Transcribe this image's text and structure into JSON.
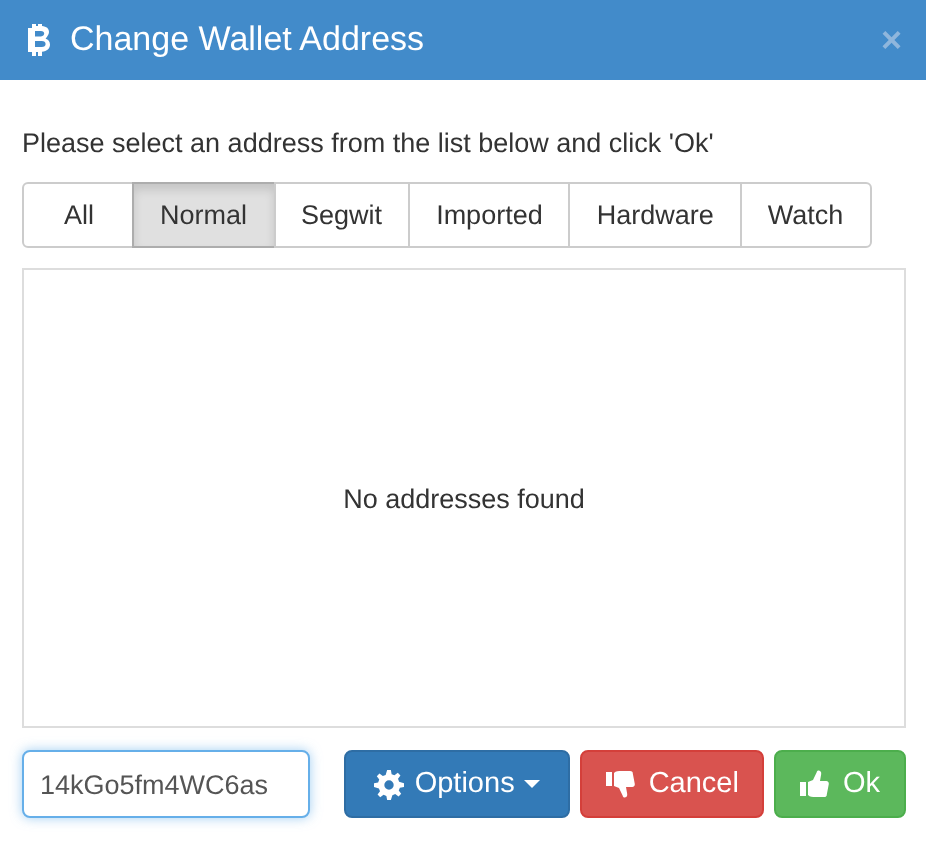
{
  "window": {
    "title": "Change Wallet Address",
    "close": "×"
  },
  "instruction": "Please select an address from the list below and click 'Ok'",
  "tabs": [
    {
      "label": "All",
      "selected": false
    },
    {
      "label": "Normal",
      "selected": true
    },
    {
      "label": "Segwit",
      "selected": false
    },
    {
      "label": "Imported",
      "selected": false
    },
    {
      "label": "Hardware",
      "selected": false
    },
    {
      "label": "Watch",
      "selected": false
    }
  ],
  "list": {
    "empty_message": "No addresses found"
  },
  "address_field": {
    "value": "14kGo5fm4WC6as"
  },
  "buttons": [
    {
      "kind": "options",
      "label": "Options"
    },
    {
      "kind": "cancel",
      "label": "Cancel"
    },
    {
      "kind": "ok",
      "label": "Ok"
    }
  ]
}
